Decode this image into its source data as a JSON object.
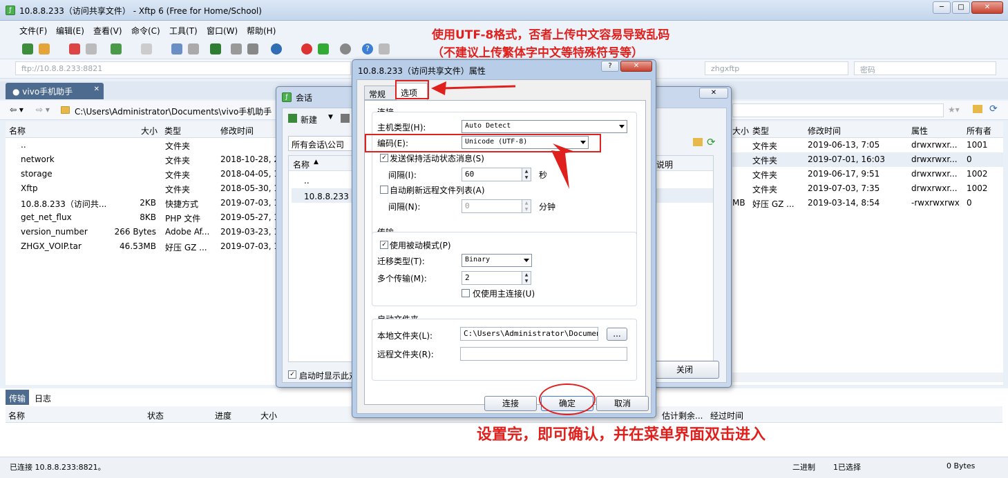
{
  "window": {
    "title": "10.8.8.233（访问共享文件） - Xftp 6 (Free for Home/School)"
  },
  "menu": [
    "文件(F)",
    "编辑(E)",
    "查看(V)",
    "命令(C)",
    "工具(T)",
    "窗口(W)",
    "帮助(H)"
  ],
  "address": {
    "host": "ftp://10.8.8.233:8821",
    "user": "zhgxftp",
    "password_placeholder": "密码"
  },
  "tab": {
    "label": "vivo手机助手",
    "close": "✕"
  },
  "local": {
    "path": "C:\\Users\\Administrator\\Documents\\vivo手机助手",
    "columns": [
      "名称",
      "大小",
      "类型",
      "修改时间"
    ],
    "rows": [
      {
        "name": "..",
        "size": "",
        "type": "文件夹",
        "mtime": ""
      },
      {
        "name": "network",
        "size": "",
        "type": "文件夹",
        "mtime": "2018-10-28, 2"
      },
      {
        "name": "storage",
        "size": "",
        "type": "文件夹",
        "mtime": "2018-04-05, 1"
      },
      {
        "name": "Xftp",
        "size": "",
        "type": "文件夹",
        "mtime": "2018-05-30, 1"
      },
      {
        "name": "10.8.8.233（访问共...",
        "size": "2KB",
        "type": "快捷方式",
        "mtime": "2019-07-03, 1"
      },
      {
        "name": "get_net_flux",
        "size": "8KB",
        "type": "PHP 文件",
        "mtime": "2019-05-27, 1"
      },
      {
        "name": "version_number",
        "size": "266 Bytes",
        "type": "Adobe Af...",
        "mtime": "2019-03-23, 1"
      },
      {
        "name": "ZHGX_VOIP.tar",
        "size": "46.53MB",
        "type": "好压 GZ ...",
        "mtime": "2019-07-03, 1"
      }
    ]
  },
  "remote": {
    "columns": [
      "大小",
      "类型",
      "修改时间",
      "属性",
      "所有者"
    ],
    "rows": [
      {
        "size": "",
        "type": "文件夹",
        "mtime": "2019-06-13, 7:05",
        "attr": "drwxrwxr...",
        "owner": "1001"
      },
      {
        "size": "",
        "type": "文件夹",
        "mtime": "2019-07-01, 16:03",
        "attr": "drwxrwxr...",
        "owner": "0"
      },
      {
        "size": "",
        "type": "文件夹",
        "mtime": "2019-06-17, 9:51",
        "attr": "drwxrwxr...",
        "owner": "1002"
      },
      {
        "size": "",
        "type": "文件夹",
        "mtime": "2019-07-03, 7:35",
        "attr": "drwxrwxr...",
        "owner": "1002"
      },
      {
        "size": "MB",
        "type": "好压 GZ ...",
        "mtime": "2019-03-14, 8:54",
        "attr": "-rwxrwxrwx",
        "owner": "0"
      }
    ]
  },
  "transfer": {
    "tabs": [
      "传输",
      "日志"
    ],
    "columns": [
      "名称",
      "状态",
      "进度",
      "大小",
      "估计剩余...",
      "经过时间"
    ]
  },
  "status": {
    "left": "已连接 10.8.8.233:8821。",
    "mode": "二进制",
    "selection": "1已选择",
    "bytes": "0 Bytes"
  },
  "session_dialog": {
    "title": "会话",
    "new_label": "新建",
    "folder_path": "所有会话\\公司",
    "col_name": "名称",
    "col_desc": "说明",
    "items": [
      "..",
      "10.8.8.233（"
    ],
    "startup_check": "启动时显示此对",
    "close": "关闭",
    "close_x": "✕"
  },
  "props_dialog": {
    "title": "10.8.8.233（访问共享文件）属性",
    "help": "?",
    "close_x": "✕",
    "tabs": [
      "常规",
      "选项"
    ],
    "conn_group": "连接",
    "host_type_label": "主机类型(H):",
    "host_type_value": "Auto Detect",
    "encoding_label": "编码(E):",
    "encoding_value": "Unicode (UTF-8)",
    "keepalive_label": "发送保持活动状态消息(S)",
    "interval_label": "间隔(I):",
    "interval_value": "60",
    "sec": "秒",
    "autorefresh_label": "自动刷新远程文件列表(A)",
    "interval2_label": "间隔(N):",
    "interval2_value": "0",
    "min": "分钟",
    "transfer_group": "传输",
    "passive_label": "使用被动模式(P)",
    "transfer_type_label": "迁移类型(T):",
    "transfer_type_value": "Binary",
    "multi_label": "多个传输(M):",
    "multi_value": "2",
    "mainconn_label": "仅使用主连接(U)",
    "startup_group": "启动文件夹",
    "local_folder_label": "本地文件夹(L):",
    "local_folder_value": "C:\\Users\\Administrator\\Documents",
    "browse": "...",
    "remote_folder_label": "远程文件夹(R):",
    "connect": "连接",
    "ok": "确定",
    "cancel": "取消"
  },
  "annotations": {
    "note1": "使用UTF-8格式，否者上传中文容易导致乱码",
    "note2": "（不建议上传繁体字中文等特殊符号等）",
    "note3": "设置完，即可确认，并在菜单界面双击进入"
  },
  "colors": {
    "annotation": "#e0201c",
    "tab_active": "#4d6b8e"
  }
}
